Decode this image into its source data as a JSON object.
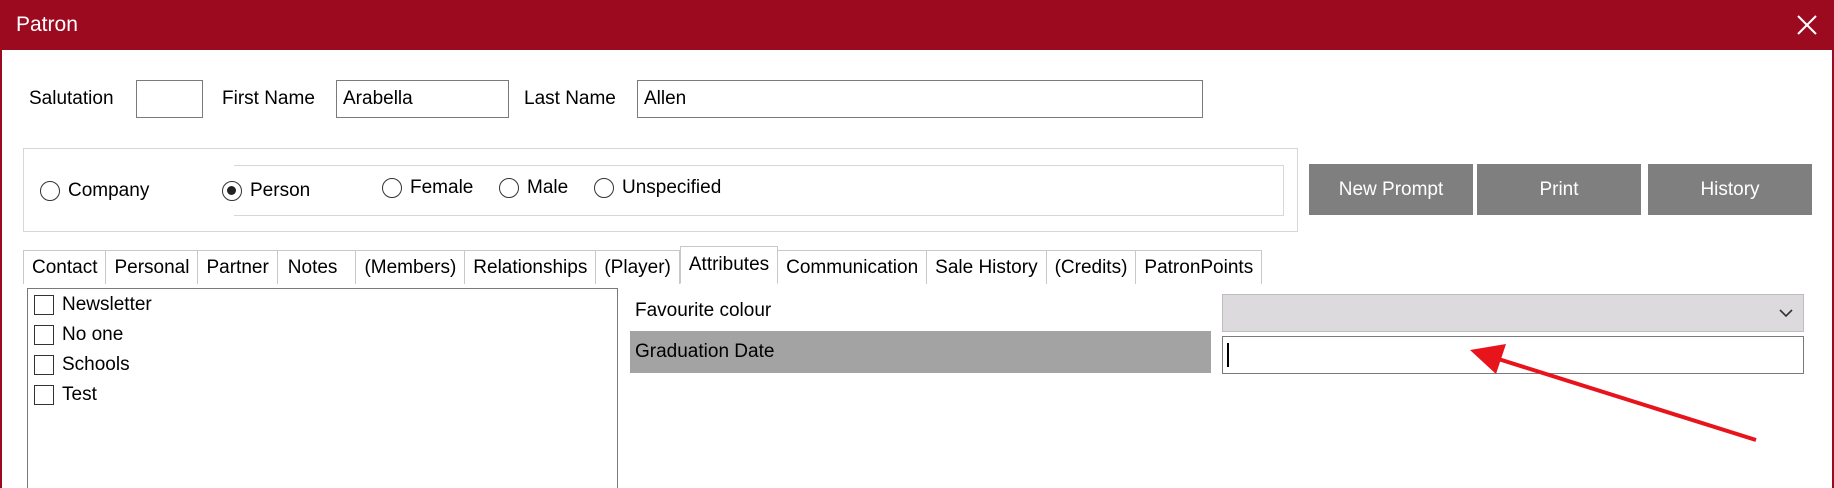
{
  "window": {
    "title": "Patron",
    "titlebar_color": "#9b0a1e",
    "close_icon": "close-icon"
  },
  "name_row": {
    "salutation_label": "Salutation",
    "salutation_value": "",
    "first_name_label": "First Name",
    "first_name_value": "Arabella",
    "last_name_label": "Last Name",
    "last_name_value": "Allen"
  },
  "patron_type": {
    "company_label": "Company",
    "person_label": "Person",
    "selected": "Person"
  },
  "gender": {
    "female_label": "Female",
    "male_label": "Male",
    "unspecified_label": "Unspecified",
    "selected": ""
  },
  "action_buttons": {
    "new_prompt": "New Prompt",
    "print": "Print",
    "history": "History",
    "button_color": "#7f7f7f"
  },
  "tabs": [
    {
      "label": "Contact"
    },
    {
      "label": "Personal"
    },
    {
      "label": "Partner"
    },
    {
      "label": "Notes"
    },
    {
      "label": "(Members)"
    },
    {
      "label": "Relationships"
    },
    {
      "label": "(Player)"
    },
    {
      "label": "Attributes"
    },
    {
      "label": "Communication"
    },
    {
      "label": "Sale History"
    },
    {
      "label": "(Credits)"
    },
    {
      "label": "PatronPoints"
    }
  ],
  "active_tab": "Attributes",
  "attribute_checkboxes": [
    {
      "label": "Newsletter",
      "checked": false
    },
    {
      "label": "No one",
      "checked": false
    },
    {
      "label": "Schools",
      "checked": false
    },
    {
      "label": "Test",
      "checked": false
    }
  ],
  "attributes": {
    "favourite_colour_label": "Favourite colour",
    "favourite_colour_value": "",
    "graduation_date_label": "Graduation Date",
    "graduation_date_value": ""
  },
  "annotation": {
    "arrow_color": "#e8141c"
  }
}
